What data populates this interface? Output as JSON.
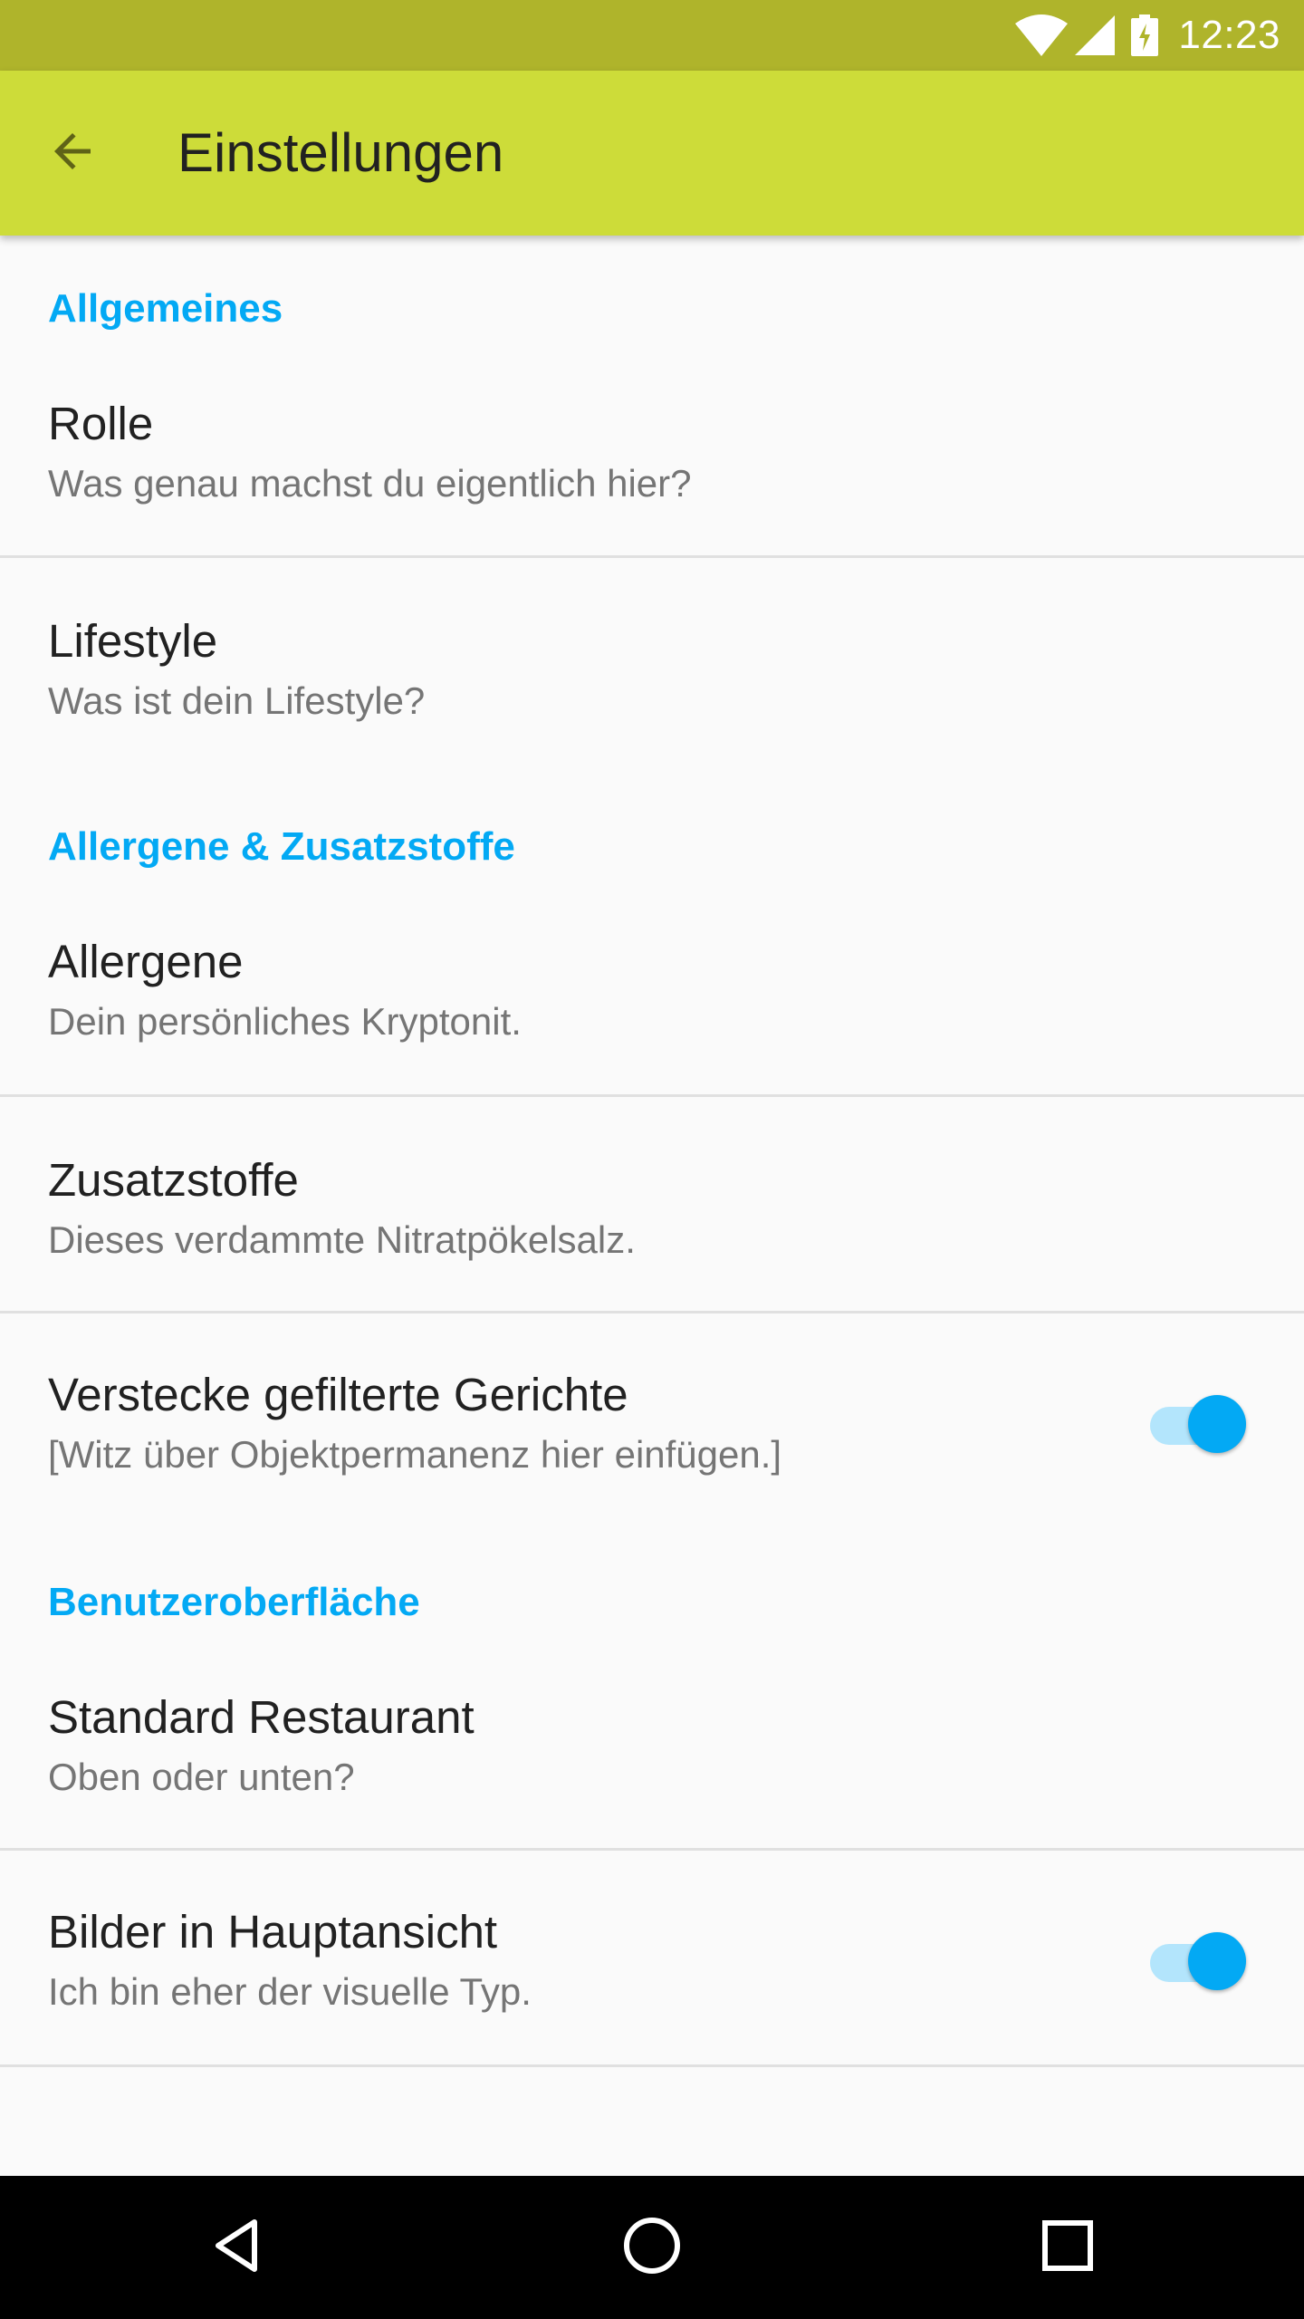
{
  "status_bar": {
    "time": "12:23",
    "icons": [
      "wifi-icon",
      "signal-icon",
      "battery-charging-icon"
    ]
  },
  "app_bar": {
    "title": "Einstellungen",
    "back_icon": "arrow-back-icon",
    "color": "#cddc39"
  },
  "sections": {
    "general": "Allgemeines",
    "allergens": "Allergene & Zusatzstoffe",
    "ui": "Benutzeroberfläche"
  },
  "prefs": {
    "role": {
      "title": "Rolle",
      "summary": "Was genau machst du eigentlich hier?"
    },
    "lifestyle": {
      "title": "Lifestyle",
      "summary": "Was ist dein Lifestyle?"
    },
    "allergens": {
      "title": "Allergene",
      "summary": "Dein persönliches Kryptonit."
    },
    "additives": {
      "title": "Zusatzstoffe",
      "summary": "Dieses verdammte Nitratpökelsalz."
    },
    "hide_filtered": {
      "title": "Verstecke gefilterte Gerichte",
      "summary": "[Witz über Objektpermanenz hier einfügen.]",
      "checked": true
    },
    "default_restaurant": {
      "title": "Standard Restaurant",
      "summary": "Oben oder unten?"
    },
    "images_main": {
      "title": "Bilder in Hauptansicht",
      "summary": "Ich bin eher der visuelle Typ.",
      "checked": true
    }
  },
  "colors": {
    "status_bar": "#afb42b",
    "accent": "#03a9f4",
    "switch_track": "#b3e5fc"
  },
  "nav_bar": {
    "icons": [
      "back-triangle-icon",
      "home-circle-icon",
      "recents-square-icon"
    ]
  }
}
